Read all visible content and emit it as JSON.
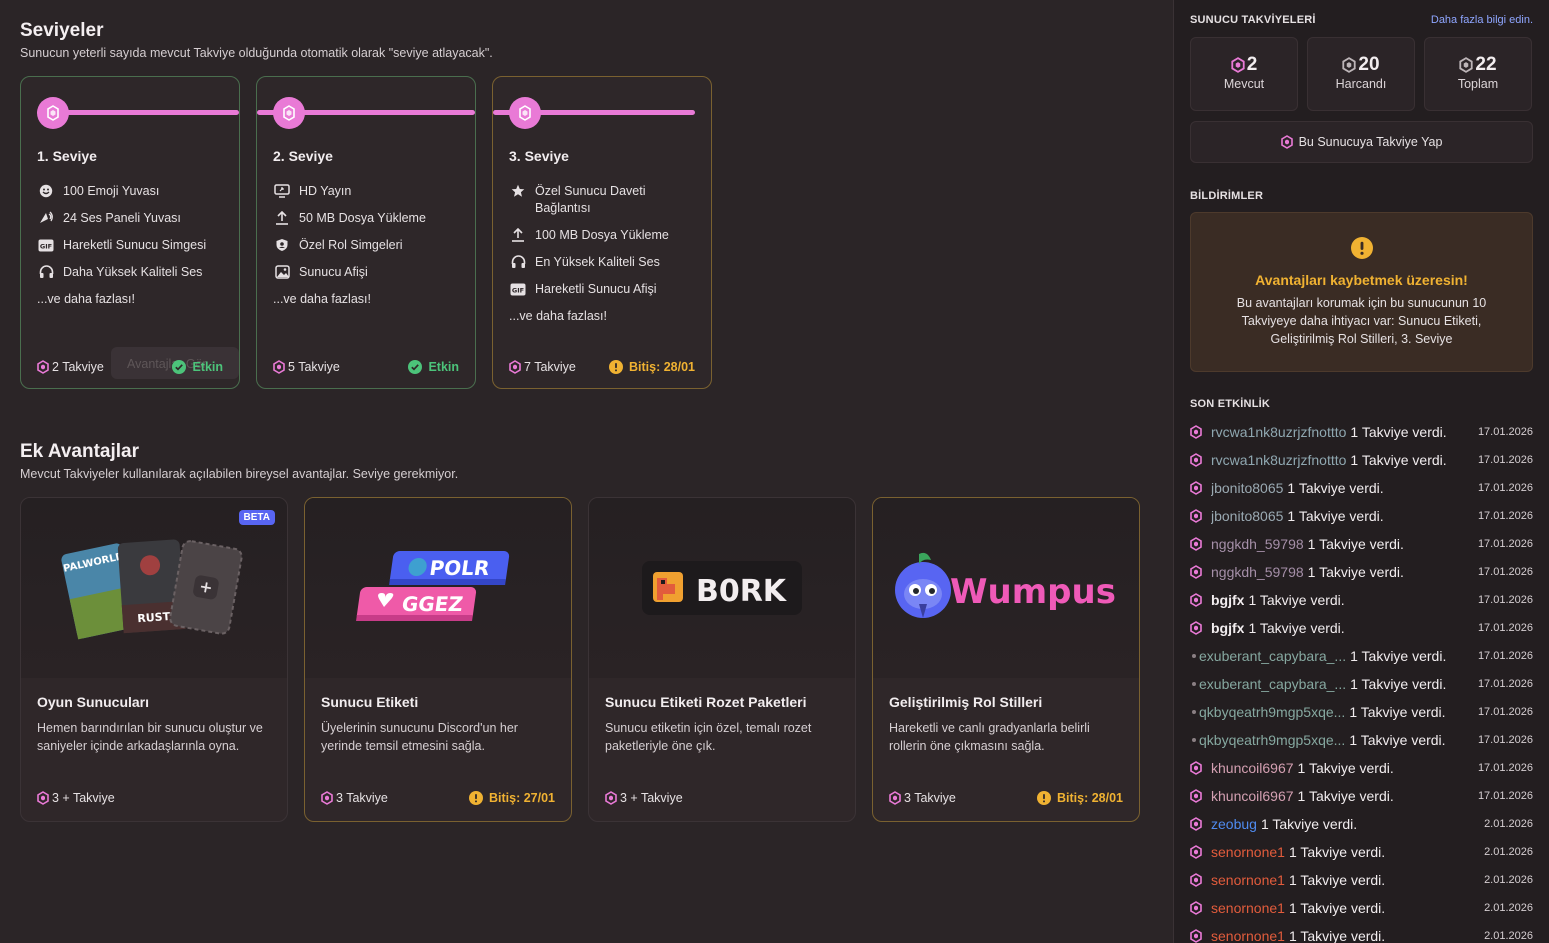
{
  "levels": {
    "title": "Seviyeler",
    "subtitle": "Sunucun yeterli sayıda mevcut Takviye olduğunda otomatik olarak \"seviye atlayacak\".",
    "tiers": [
      {
        "title": "1. Seviye",
        "perks": [
          "100 Emoji Yuvası",
          "24 Ses Paneli Yuvası",
          "Hareketli Sunucu Simgesi",
          "Daha Yüksek Kaliteli Ses"
        ],
        "more": "...ve daha fazlası!",
        "boosts": "2 Takviye",
        "status": "Etkin",
        "ghost": "Avantajlar Gör"
      },
      {
        "title": "2. Seviye",
        "perks": [
          "HD Yayın",
          "50 MB Dosya Yükleme",
          "Özel Rol Simgeleri",
          "Sunucu Afişi"
        ],
        "more": "...ve daha fazlası!",
        "boosts": "5 Takviye",
        "status": "Etkin"
      },
      {
        "title": "3. Seviye",
        "perks": [
          "Özel Sunucu Daveti Bağlantısı",
          "100 MB Dosya Yükleme",
          "En Yüksek Kaliteli Ses",
          "Hareketli Sunucu Afişi"
        ],
        "more": "...ve daha fazlası!",
        "boosts": "7 Takviye",
        "status": "Bitiş: 28/01"
      }
    ]
  },
  "extra": {
    "title": "Ek Avantajlar",
    "subtitle": "Mevcut Takviyeler kullanılarak açılabilen bireysel avantajlar. Seviye gerekmiyor.",
    "cards": [
      {
        "title": "Oyun Sunucuları",
        "desc": "Hemen barındırılan bir sunucu oluştur ve saniyeler içinde arkadaşlarınla oyna.",
        "boosts": "3 + Takviye",
        "status": "",
        "badge": "BETA",
        "art1": "PALWORLD",
        "art2": "RUST"
      },
      {
        "title": "Sunucu Etiketi",
        "desc": "Üyelerinin sunucunu Discord'un her yerinde temsil etmesini sağla.",
        "boosts": "3 Takviye",
        "status": "Bitiş: 27/01",
        "art1": "POLR",
        "art2": "GGEZ"
      },
      {
        "title": "Sunucu Etiketi Rozet Paketleri",
        "desc": "Sunucu etiketin için özel, temalı rozet paketleriyle öne çık.",
        "boosts": "3 + Takviye",
        "status": "",
        "art1": "B0RK"
      },
      {
        "title": "Geliştirilmiş Rol Stilleri",
        "desc": "Hareketli ve canlı gradyanlarla belirli rollerin öne çıkmasını sağla.",
        "boosts": "3 Takviye",
        "status": "Bitiş: 28/01",
        "art1": "Wumpus"
      }
    ]
  },
  "sidebar": {
    "boosts_label": "SUNUCU TAKVİYELERİ",
    "more_link": "Daha fazla bilgi edin.",
    "stats": [
      {
        "num": "2",
        "label": "Mevcut"
      },
      {
        "num": "20",
        "label": "Harcandı"
      },
      {
        "num": "22",
        "label": "Toplam"
      }
    ],
    "boost_button": "Bu Sunucuya Takviye Yap",
    "notif_label": "BİLDİRİMLER",
    "notif_title": "Avantajları kaybetmek üzeresin!",
    "notif_desc": "Bu avantajları korumak için bu sunucunun 10 Takviyeye daha ihtiyacı var: Sunucu Etiketi, Geliştirilmiş Rol Stilleri, 3. Seviye",
    "activity_label": "SON ETKİNLİK",
    "activity": [
      {
        "name": "rvcwa1nk8uzrjzfnottto",
        "color": "#8fa7b0",
        "text": "1 Takviye verdi.",
        "date": "17.01.2026"
      },
      {
        "name": "rvcwa1nk8uzrjzfnottto",
        "color": "#8fa7b0",
        "text": "1 Takviye verdi.",
        "date": "17.01.2026"
      },
      {
        "name": "jbonito8065",
        "color": "#9aa9b2",
        "text": "1 Takviye verdi.",
        "date": "17.01.2026"
      },
      {
        "name": "jbonito8065",
        "color": "#9aa9b2",
        "text": "1 Takviye verdi.",
        "date": "17.01.2026"
      },
      {
        "name": "nggkdh_59798",
        "color": "#a58fa8",
        "text": "1 Takviye verdi.",
        "date": "17.01.2026"
      },
      {
        "name": "nggkdh_59798",
        "color": "#a58fa8",
        "text": "1 Takviye verdi.",
        "date": "17.01.2026"
      },
      {
        "name": "bgjfx",
        "color": "#f2edef",
        "text": "1 Takviye verdi.",
        "date": "17.01.2026"
      },
      {
        "name": "bgjfx",
        "color": "#f2edef",
        "text": "1 Takviye verdi.",
        "date": "17.01.2026"
      },
      {
        "name": "exuberant_capybara_...",
        "color": "#86a8a0",
        "text": "1 Takviye verdi.",
        "date": "17.01.2026"
      },
      {
        "name": "exuberant_capybara_...",
        "color": "#86a8a0",
        "text": "1 Takviye verdi.",
        "date": "17.01.2026"
      },
      {
        "name": "qkbyqeatrh9mgp5xqe...",
        "color": "#86a8a0",
        "text": "1 Takviye verdi.",
        "date": "17.01.2026"
      },
      {
        "name": "qkbyqeatrh9mgp5xqe...",
        "color": "#86a8a0",
        "text": "1 Takviye verdi.",
        "date": "17.01.2026"
      },
      {
        "name": "khuncoil6967",
        "color": "#d4a0b2",
        "text": "1 Takviye verdi.",
        "date": "17.01.2026"
      },
      {
        "name": "khuncoil6967",
        "color": "#d4a0b2",
        "text": "1 Takviye verdi.",
        "date": "17.01.2026"
      },
      {
        "name": "zeobug",
        "color": "#4f8bf0",
        "text": "1 Takviye verdi.",
        "date": "2.01.2026"
      },
      {
        "name": "senornone1",
        "color": "#e25c3c",
        "text": "1 Takviye verdi.",
        "date": "2.01.2026"
      },
      {
        "name": "senornone1",
        "color": "#e25c3c",
        "text": "1 Takviye verdi.",
        "date": "2.01.2026"
      },
      {
        "name": "senornone1",
        "color": "#e25c3c",
        "text": "1 Takviye verdi.",
        "date": "2.01.2026"
      },
      {
        "name": "senornone1",
        "color": "#e25c3c",
        "text": "1 Takviye verdi.",
        "date": "2.01.2026"
      }
    ]
  },
  "colors": {
    "boost_pink": "#e97ad6",
    "active_green": "#4cc37a",
    "warning_gold": "#f0b232",
    "link_blue": "#8fa6ff"
  }
}
